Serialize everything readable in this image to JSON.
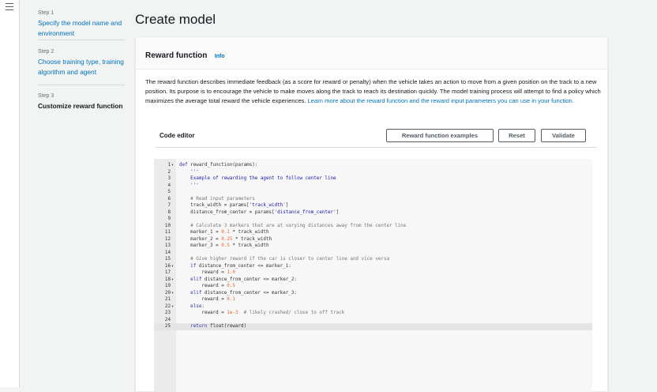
{
  "nav": {
    "menu_icon": "hamburger-icon"
  },
  "steps": [
    {
      "num": "Step 1",
      "title": "Specify the model name and environment",
      "state": "link"
    },
    {
      "num": "Step 2",
      "title": "Choose training type, training algorithm and agent",
      "state": "link"
    },
    {
      "num": "Step 3",
      "title": "Customize reward function",
      "state": "current"
    }
  ],
  "page": {
    "title": "Create model"
  },
  "panel": {
    "title": "Reward function",
    "info": "Info",
    "description": "The reward function describes immediate feedback (as a score for reward or penalty) when the vehicle takes an action to move from a given position on the track to a new position. Its purpose is to encourage the vehicle to make moves along the track to reach its destination quickly. The model training process will attempt to find a policy which maximizes the average total reward the vehicle experiences.",
    "learn_more": "Learn more about the reward function and the reward input parameters you can use in your function."
  },
  "editor": {
    "label": "Code editor",
    "buttons": {
      "examples": "Reward function examples",
      "reset": "Reset",
      "validate": "Validate"
    },
    "lines": [
      {
        "n": "1",
        "fold": "▾",
        "segs": [
          [
            "kw",
            "def "
          ],
          [
            "fn",
            "reward_function(params):"
          ]
        ]
      },
      {
        "n": "2",
        "fold": "",
        "segs": [
          [
            "str",
            "    '''"
          ]
        ]
      },
      {
        "n": "3",
        "fold": "",
        "segs": [
          [
            "str",
            "    Example of rewarding the agent to follow center line"
          ]
        ]
      },
      {
        "n": "4",
        "fold": "",
        "segs": [
          [
            "str",
            "    '''"
          ]
        ]
      },
      {
        "n": "5",
        "fold": "",
        "segs": [
          [
            "",
            "    "
          ]
        ]
      },
      {
        "n": "6",
        "fold": "",
        "segs": [
          [
            "cm",
            "    # Read input parameters"
          ]
        ]
      },
      {
        "n": "7",
        "fold": "",
        "segs": [
          [
            "",
            "    track_width = params["
          ],
          [
            "str",
            "'track_width'"
          ],
          [
            "",
            "]"
          ]
        ]
      },
      {
        "n": "8",
        "fold": "",
        "segs": [
          [
            "",
            "    distance_from_center = params["
          ],
          [
            "str",
            "'distance_from_center'"
          ],
          [
            "",
            "]"
          ]
        ]
      },
      {
        "n": "9",
        "fold": "",
        "segs": [
          [
            "",
            "    "
          ]
        ]
      },
      {
        "n": "10",
        "fold": "",
        "segs": [
          [
            "cm",
            "    # Calculate 3 markers that are at varying distances away from the center line"
          ]
        ]
      },
      {
        "n": "11",
        "fold": "",
        "segs": [
          [
            "",
            "    marker_1 = "
          ],
          [
            "num",
            "0.1"
          ],
          [
            "",
            " * track_width"
          ]
        ]
      },
      {
        "n": "12",
        "fold": "",
        "segs": [
          [
            "",
            "    marker_2 = "
          ],
          [
            "num",
            "0.25"
          ],
          [
            "",
            " * track_width"
          ]
        ]
      },
      {
        "n": "13",
        "fold": "",
        "segs": [
          [
            "",
            "    marker_3 = "
          ],
          [
            "num",
            "0.5"
          ],
          [
            "",
            " * track_width"
          ]
        ]
      },
      {
        "n": "14",
        "fold": "",
        "segs": [
          [
            "",
            "    "
          ]
        ]
      },
      {
        "n": "15",
        "fold": "",
        "segs": [
          [
            "cm",
            "    # Give higher reward if the car is closer to center line and vice versa"
          ]
        ]
      },
      {
        "n": "16",
        "fold": "▾",
        "segs": [
          [
            "kw",
            "    if "
          ],
          [
            "",
            "distance_from_center <= marker_1:"
          ]
        ]
      },
      {
        "n": "17",
        "fold": "",
        "segs": [
          [
            "",
            "        reward = "
          ],
          [
            "num",
            "1.0"
          ]
        ]
      },
      {
        "n": "18",
        "fold": "▾",
        "segs": [
          [
            "kw",
            "    elif "
          ],
          [
            "",
            "distance_from_center <= marker_2:"
          ]
        ]
      },
      {
        "n": "19",
        "fold": "",
        "segs": [
          [
            "",
            "        reward = "
          ],
          [
            "num",
            "0.5"
          ]
        ]
      },
      {
        "n": "20",
        "fold": "▾",
        "segs": [
          [
            "kw",
            "    elif "
          ],
          [
            "",
            "distance_from_center <= marker_3:"
          ]
        ]
      },
      {
        "n": "21",
        "fold": "",
        "segs": [
          [
            "",
            "        reward = "
          ],
          [
            "num",
            "0.1"
          ]
        ]
      },
      {
        "n": "22",
        "fold": "▾",
        "segs": [
          [
            "kw",
            "    else"
          ],
          [
            ":"
          ]
        ]
      },
      {
        "n": "23",
        "fold": "",
        "segs": [
          [
            "",
            "        reward = "
          ],
          [
            "num",
            "1e-3"
          ],
          [
            "",
            "  "
          ],
          [
            "cm",
            "# likely crashed/ close to off track"
          ]
        ]
      },
      {
        "n": "24",
        "fold": "",
        "segs": [
          [
            "",
            "    "
          ]
        ]
      },
      {
        "n": "25",
        "fold": "",
        "segs": [
          [
            "kw",
            "    return "
          ],
          [
            "",
            "float(reward)"
          ]
        ],
        "active": true
      }
    ]
  }
}
